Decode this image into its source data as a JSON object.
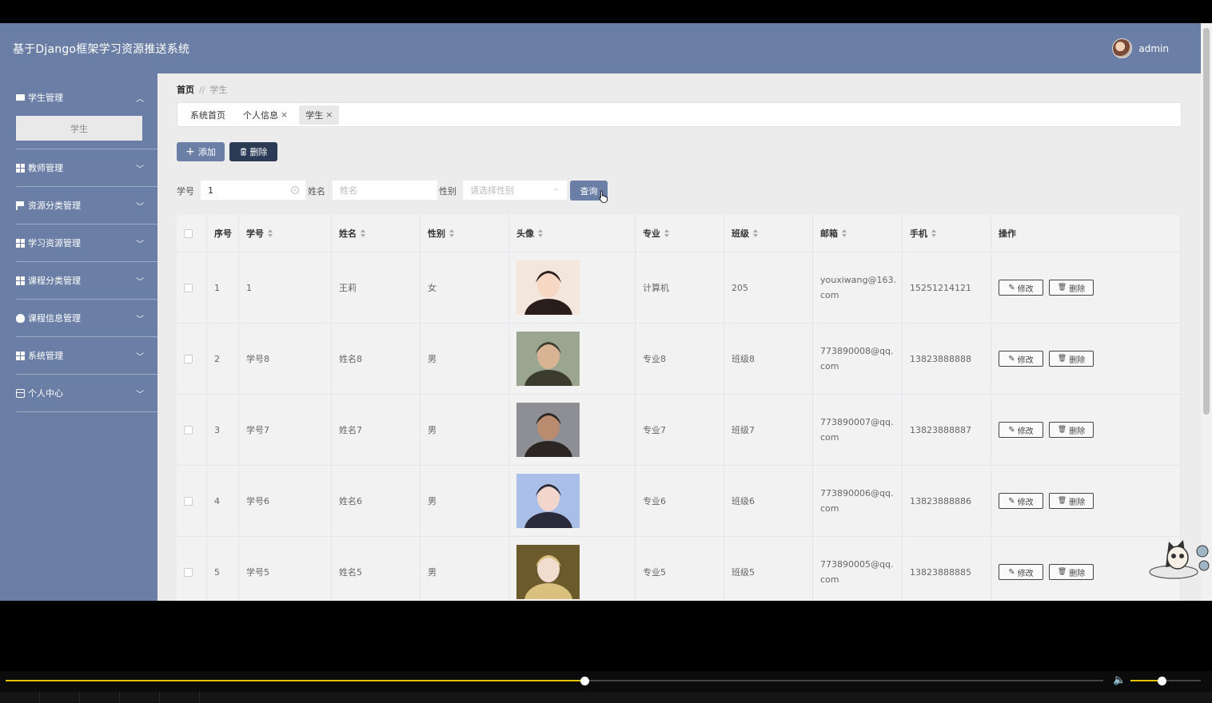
{
  "app": {
    "title": "基于Django框架学习资源推送系统",
    "user": "admin"
  },
  "sidebar": {
    "groups": [
      {
        "label": "学生管理",
        "icon": "chat-icon",
        "expanded": true,
        "children": [
          "学生"
        ]
      },
      {
        "label": "教师管理",
        "icon": "grid-icon"
      },
      {
        "label": "资源分类管理",
        "icon": "flag-icon"
      },
      {
        "label": "学习资源管理",
        "icon": "grid-icon"
      },
      {
        "label": "课程分类管理",
        "icon": "grid-icon"
      },
      {
        "label": "课程信息管理",
        "icon": "bulb-icon"
      },
      {
        "label": "系统管理",
        "icon": "grid-icon"
      },
      {
        "label": "个人中心",
        "icon": "card-icon"
      }
    ]
  },
  "breadcrumb": {
    "home": "首页",
    "separator": "//",
    "current": "学生"
  },
  "tabs": [
    {
      "label": "系统首页",
      "closable": false
    },
    {
      "label": "个人信息",
      "closable": true
    },
    {
      "label": "学生",
      "closable": true,
      "active": true
    }
  ],
  "toolbar": {
    "add_label": "添加",
    "delete_label": "删除"
  },
  "filters": {
    "student_no_label": "学号",
    "student_no_value": "1",
    "name_label": "姓名",
    "name_placeholder": "姓名",
    "gender_label": "性别",
    "gender_placeholder": "请选择性别",
    "search_label": "查询"
  },
  "table": {
    "headers": [
      "序号",
      "学号",
      "姓名",
      "性别",
      "头像",
      "专业",
      "班级",
      "邮箱",
      "手机",
      "操作"
    ],
    "rows": [
      {
        "index": "1",
        "student_no": "1",
        "name": "王莉",
        "gender": "女",
        "major": "计算机",
        "class": "205",
        "email": "youxiwang@163.com",
        "phone": "15251214121"
      },
      {
        "index": "2",
        "student_no": "学号8",
        "name": "姓名8",
        "gender": "男",
        "major": "专业8",
        "class": "班级8",
        "email": "773890008@qq.com",
        "phone": "13823888888"
      },
      {
        "index": "3",
        "student_no": "学号7",
        "name": "姓名7",
        "gender": "男",
        "major": "专业7",
        "class": "班级7",
        "email": "773890007@qq.com",
        "phone": "13823888887"
      },
      {
        "index": "4",
        "student_no": "学号6",
        "name": "姓名6",
        "gender": "男",
        "major": "专业6",
        "class": "班级6",
        "email": "773890006@qq.com",
        "phone": "13823888886"
      },
      {
        "index": "5",
        "student_no": "学号5",
        "name": "姓名5",
        "gender": "男",
        "major": "专业5",
        "class": "班级5",
        "email": "773890005@qq.com",
        "phone": "13823888885"
      }
    ],
    "edit_label": "修改",
    "delete_label": "删除"
  },
  "player": {
    "progress_fraction": 0.527,
    "volume_fraction": 0.44
  },
  "colors": {
    "primary": "#6b7fa6",
    "dark_button": "#2b3a55",
    "accent_progress": "#e6c200"
  }
}
